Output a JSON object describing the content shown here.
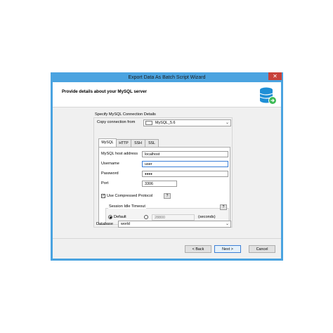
{
  "window": {
    "title": "Export Data As Batch Script Wizard",
    "close_glyph": "✕",
    "heading": "Provide details about your MySQL server"
  },
  "connection": {
    "group_label": "Specify MySQL Connection Details",
    "copy_label": "Copy connection from",
    "copy_value": "MySQL_5.6"
  },
  "tabs": [
    {
      "label": "MySQL",
      "active": true
    },
    {
      "label": "HTTP",
      "active": false
    },
    {
      "label": "SSH",
      "active": false
    },
    {
      "label": "SSL",
      "active": false
    }
  ],
  "fields": {
    "host_label": "MySQL host address",
    "host_value": "localhost",
    "user_label": "Username",
    "user_value": "user",
    "password_label": "Password",
    "password_value": "●●●●",
    "port_label": "Port",
    "port_value": "3306"
  },
  "compression": {
    "label": "Use Compressed Protocol",
    "checked": true,
    "help": "?"
  },
  "idle": {
    "group_label": "Session Idle Timeout",
    "help": "?",
    "default_label": "Default",
    "custom_value": "28800",
    "unit": "(seconds)"
  },
  "database": {
    "label": "Database",
    "value": "world"
  },
  "buttons": {
    "back": "< Back",
    "next": "Next >",
    "cancel": "Cancel"
  },
  "colors": {
    "titlebar": "#4aa3e0",
    "close": "#c7413a",
    "icon_blue": "#1f8fd6",
    "icon_green": "#3dbb56"
  }
}
